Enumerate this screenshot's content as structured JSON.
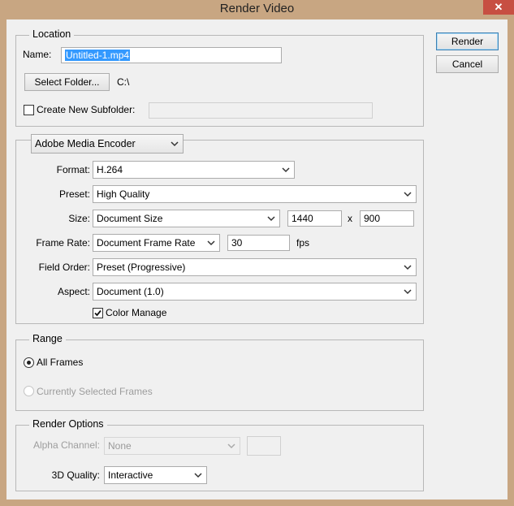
{
  "window": {
    "title": "Render Video",
    "close_glyph": "✕"
  },
  "buttons": {
    "render": "Render",
    "cancel": "Cancel"
  },
  "location": {
    "title": "Location",
    "name_label": "Name:",
    "name_value": "Untitled-1.mp4",
    "select_folder": "Select Folder...",
    "folder_path": "C:\\",
    "subfolder_label": "Create New Subfolder:",
    "subfolder_checked": false,
    "subfolder_value": ""
  },
  "encoder": {
    "selected": "Adobe Media Encoder",
    "format_label": "Format:",
    "format_value": "H.264",
    "preset_label": "Preset:",
    "preset_value": "High Quality",
    "size_label": "Size:",
    "size_value": "Document Size",
    "width": "1440",
    "size_x": "x",
    "height": "900",
    "frame_rate_label": "Frame Rate:",
    "frame_rate_value": "Document Frame Rate",
    "fps_value": "30",
    "fps_unit": "fps",
    "field_order_label": "Field Order:",
    "field_order_value": "Preset (Progressive)",
    "aspect_label": "Aspect:",
    "aspect_value": "Document (1.0)",
    "color_manage_label": "Color Manage",
    "color_manage_checked": true
  },
  "range": {
    "title": "Range",
    "all_frames": "All Frames",
    "all_frames_selected": true,
    "selected_frames": "Currently Selected Frames",
    "selected_frames_enabled": false
  },
  "render_options": {
    "title": "Render Options",
    "alpha_label": "Alpha Channel:",
    "alpha_value": "None",
    "quality_label": "3D Quality:",
    "quality_value": "Interactive"
  },
  "icons": {
    "dropdown": "chevron-down-icon",
    "check": "check-icon"
  }
}
